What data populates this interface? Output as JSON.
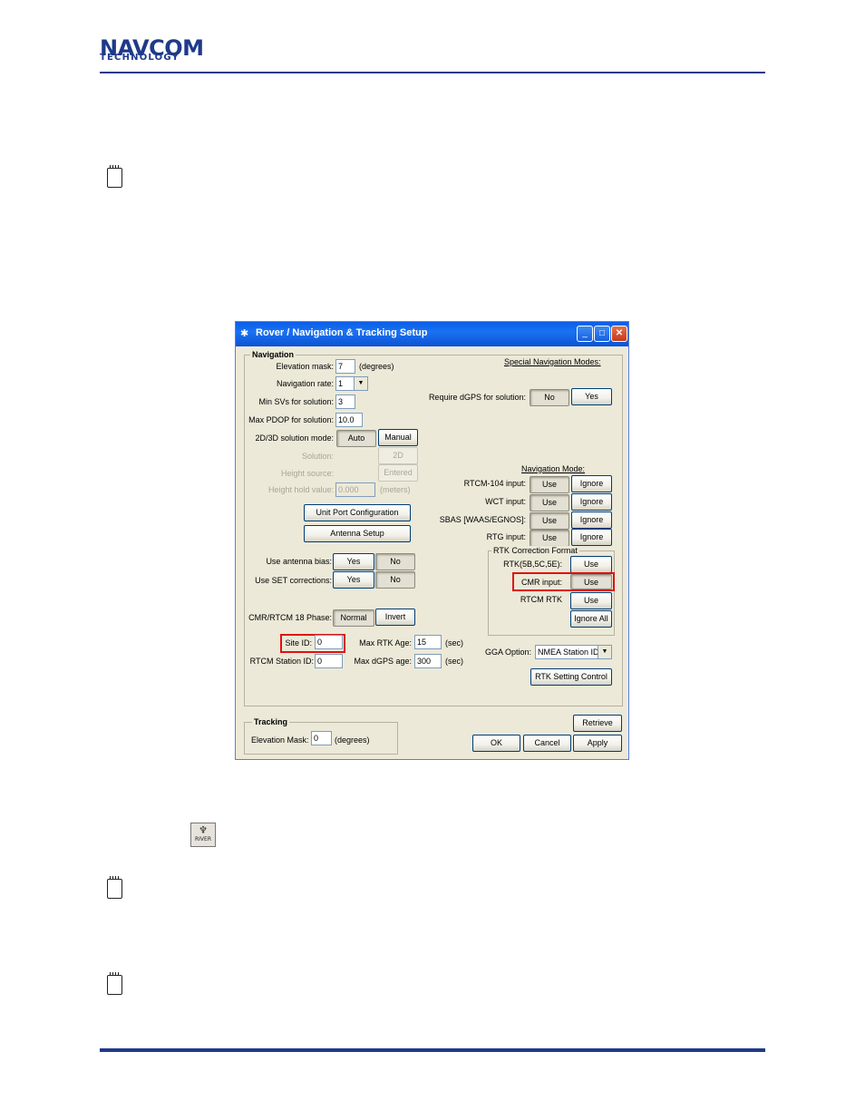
{
  "header": {
    "logo_line1": "NAVCOM",
    "logo_line2": "TECHNOLOGY"
  },
  "dialog": {
    "title": "Rover / Navigation & Tracking Setup",
    "navigation": {
      "group_title": "Navigation",
      "elevation_mask_label": "Elevation mask:",
      "elevation_mask_value": "7",
      "elevation_mask_unit": "(degrees)",
      "navigation_rate_label": "Navigation rate:",
      "navigation_rate_value": "1",
      "min_svs_label": "Min SVs for solution:",
      "min_svs_value": "3",
      "max_pdop_label": "Max PDOP for solution:",
      "max_pdop_value": "10.0",
      "solution_mode_label": "2D/3D solution mode:",
      "auto_label": "Auto",
      "manual_label": "Manual",
      "solution_label": "Solution:",
      "solution_value": "2D",
      "height_source_label": "Height source:",
      "height_source_value": "Entered",
      "height_hold_label": "Height hold value:",
      "height_hold_value": "0.000",
      "height_hold_unit": "(meters)",
      "unit_port_button": "Unit Port Configuration",
      "antenna_setup_button": "Antenna Setup",
      "use_antenna_bias_label": "Use antenna bias:",
      "use_set_corrections_label": "Use SET corrections:",
      "yes_label": "Yes",
      "no_label": "No",
      "cmr_phase_label": "CMR/RTCM 18 Phase:",
      "normal_label": "Normal",
      "invert_label": "Invert",
      "site_id_label": "Site ID:",
      "site_id_value": "0",
      "max_rtk_age_label": "Max RTK Age:",
      "max_rtk_age_value": "15",
      "sec_unit": "(sec)",
      "rtcm_station_id_label": "RTCM Station ID:",
      "rtcm_station_id_value": "0",
      "max_dgps_age_label": "Max dGPS age:",
      "max_dgps_age_value": "300",
      "special_modes_label": "Special Navigation Modes:",
      "require_dgps_label": "Require dGPS for solution:",
      "navigation_mode_label": "Navigation Mode:",
      "use_label": "Use",
      "ignore_label": "Ignore",
      "rtcm104_label": "RTCM-104 input:",
      "wct_label": "WCT input:",
      "sbas_label": "SBAS [WAAS/EGNOS]:",
      "rtg_label": "RTG input:",
      "rtk_correction_format_label": "RTK Correction Format",
      "rtk_5b_label": "RTK(5B,5C,5E):",
      "cmr_input_label": "CMR input:",
      "rtcm_rtk_label": "RTCM RTK",
      "ignore_all_label": "Ignore All",
      "gga_option_label": "GGA Option:",
      "gga_option_value": "NMEA Station ID",
      "rtk_setting_button": "RTK Setting Control"
    },
    "tracking": {
      "group_title": "Tracking",
      "elevation_mask_label": "Elevation Mask:",
      "elevation_mask_value": "0",
      "unit": "(degrees)"
    },
    "buttons": {
      "retrieve": "Retrieve",
      "ok": "OK",
      "cancel": "Cancel",
      "apply": "Apply"
    }
  },
  "river_icon": {
    "label": "RIVER"
  },
  "colors": {
    "brand": "#1f3a8a",
    "titlebar": "#0a5ee8",
    "dialog_bg": "#ece9d8",
    "highlight": "#e01010"
  }
}
